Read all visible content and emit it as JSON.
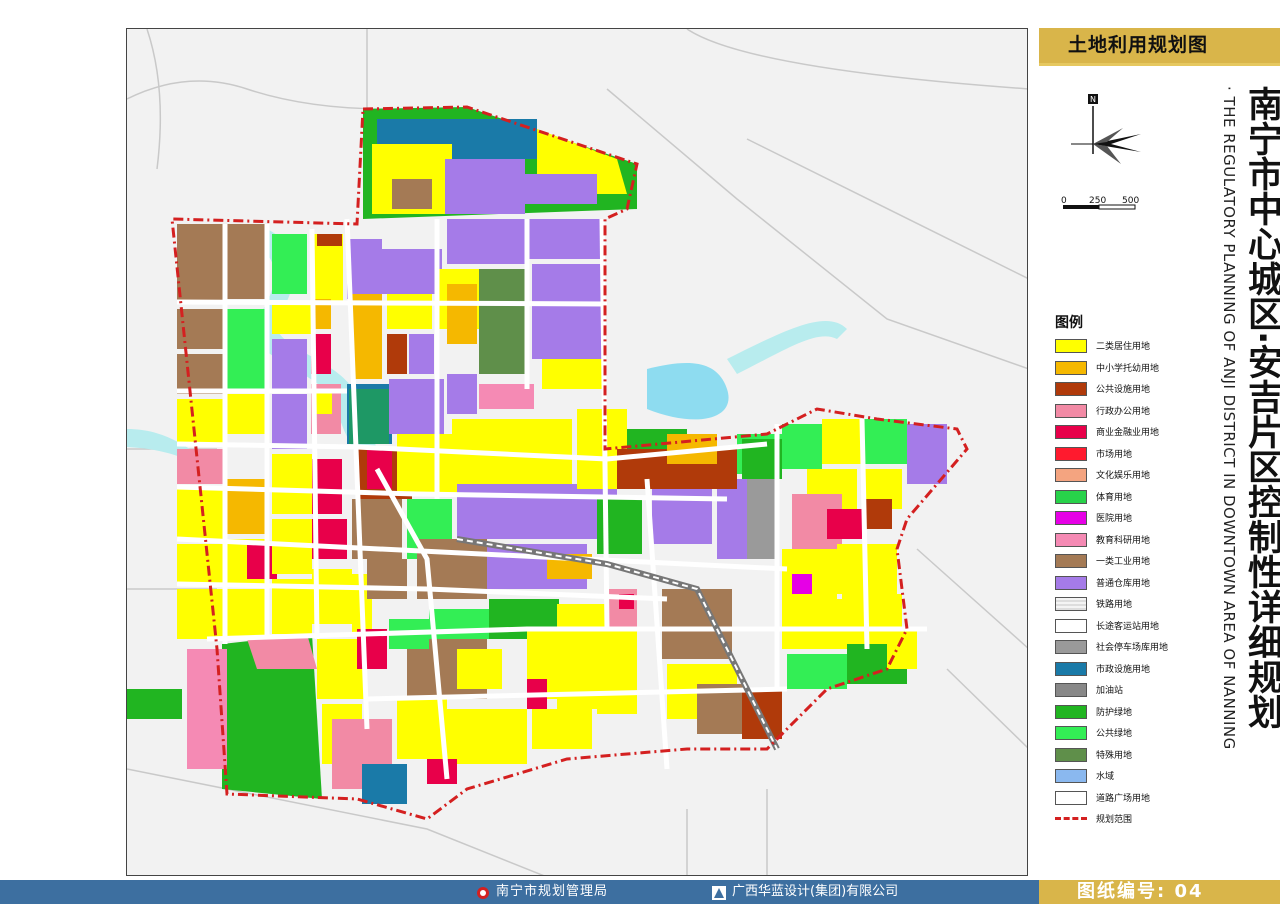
{
  "panel": {
    "title": "土地利用规划图",
    "title_cn": "南宁市中心城区·安吉片区控制性详细规划",
    "title_en": "· THE REGULATORY PLANNING OF ANJI DISTRICT IN DOWNTOWN AREA OF NANNING",
    "north_label": "N",
    "scale_labels": [
      "0",
      "250",
      "500"
    ],
    "legend_heading": "图例"
  },
  "legend": [
    {
      "label": "二类居住用地",
      "color": "#ffff00"
    },
    {
      "label": "中小学托幼用地",
      "color": "#f5b800"
    },
    {
      "label": "公共设施用地",
      "color": "#b03a0a"
    },
    {
      "label": "行政办公用地",
      "color": "#f28aa5"
    },
    {
      "label": "商业金融业用地",
      "color": "#e8004a"
    },
    {
      "label": "市场用地",
      "color": "#ff1a2e"
    },
    {
      "label": "文化娱乐用地",
      "color": "#f4a480"
    },
    {
      "label": "体育用地",
      "color": "#28d24a"
    },
    {
      "label": "医院用地",
      "color": "#e600e6"
    },
    {
      "label": "教育科研用地",
      "color": "#f58ab4"
    },
    {
      "label": "一类工业用地",
      "color": "#a47a55"
    },
    {
      "label": "普通仓库用地",
      "color": "#a57be8"
    },
    {
      "label": "铁路用地",
      "color": "#e6e6e6"
    },
    {
      "label": "长途客运站用地",
      "color": "#ffffff"
    },
    {
      "label": "社会停车场库用地",
      "color": "#9a9a9a"
    },
    {
      "label": "市政设施用地",
      "color": "#1a7aa8"
    },
    {
      "label": "加油站",
      "color": "#888888"
    },
    {
      "label": "防护绿地",
      "color": "#21b521"
    },
    {
      "label": "公共绿地",
      "color": "#33ee55"
    },
    {
      "label": "特殊用地",
      "color": "#5f8f4a"
    },
    {
      "label": "水域",
      "color": "#8ab8ef"
    },
    {
      "label": "道路广场用地",
      "color": "#ffffff"
    },
    {
      "label": "规划范围",
      "color": "#d42020"
    }
  ],
  "footer": {
    "org1": "南宁市规划管理局",
    "org2": "广西华蓝设计(集团)有限公司",
    "drawing_label": "图纸编号: 04"
  }
}
